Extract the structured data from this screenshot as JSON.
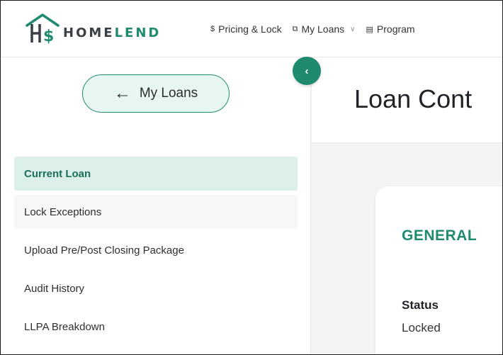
{
  "brand": {
    "name_part1": "HOME",
    "name_part2": "LEND",
    "accent_color": "#1f8a70"
  },
  "nav": {
    "items": [
      {
        "label": "Pricing & Lock",
        "icon": "dollar-icon"
      },
      {
        "label": "My Loans",
        "icon": "loans-icon",
        "has_dropdown": true
      },
      {
        "label": "Program",
        "icon": "document-icon"
      }
    ]
  },
  "sidebar": {
    "back_button_label": "My Loans",
    "collapse_icon": "chevron-left-icon",
    "items": [
      {
        "label": "Current Loan",
        "active": true
      },
      {
        "label": "Lock Exceptions",
        "active": false
      },
      {
        "label": "Upload Pre/Post Closing Package",
        "active": false
      },
      {
        "label": "Audit History",
        "active": false
      },
      {
        "label": "LLPA Breakdown",
        "active": false
      }
    ]
  },
  "main": {
    "title": "Loan Cont",
    "card": {
      "heading": "GENERAL",
      "fields": [
        {
          "label": "Status",
          "value": "Locked"
        }
      ]
    }
  }
}
